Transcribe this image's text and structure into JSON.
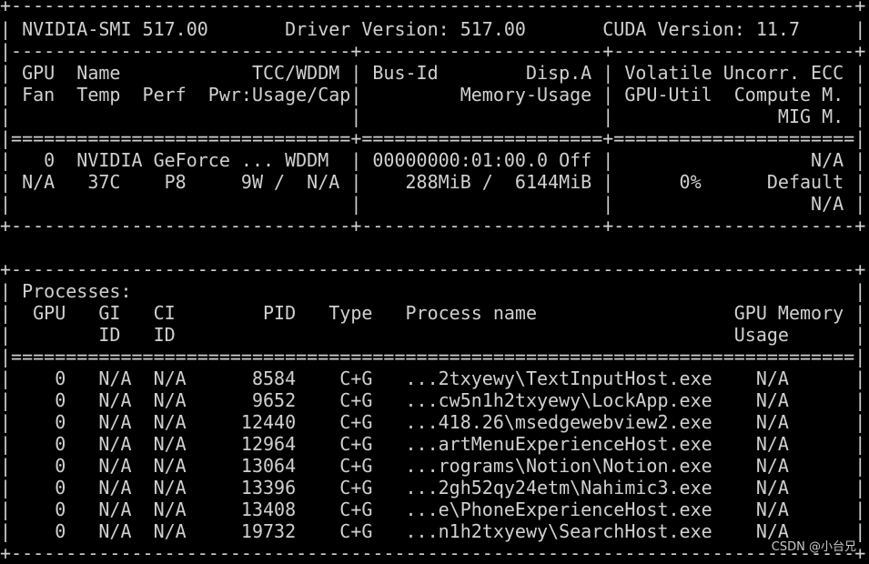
{
  "terminal": {
    "header": {
      "border_top": "+-----------------------------------------------------------------------------+",
      "title_line": "| NVIDIA-SMI 517.00       Driver Version: 517.00       CUDA Version: 11.7     |",
      "rule_mid": "|-------------------------------+----------------------+----------------------+",
      "col_head_1": "| GPU  Name            TCC/WDDM | Bus-Id        Disp.A | Volatile Uncorr. ECC |",
      "col_head_2": "| Fan  Temp  Perf  Pwr:Usage/Cap|         Memory-Usage | GPU-Util  Compute M. |",
      "col_head_3": "|                               |                      |               MIG M. |",
      "rule_eq": "|===============================+======================+======================|"
    },
    "gpu_row": {
      "line_1": "|   0  NVIDIA GeForce ... WDDM  | 00000000:01:00.0 Off |                  N/A |",
      "line_2": "| N/A   37C    P8     9W /  N/A |    288MiB /  6144MiB |      0%      Default |",
      "line_3": "|                               |                      |                  N/A |",
      "border_bottom": "+-------------------------------+----------------------+----------------------+"
    },
    "processes": {
      "border_top": "+-----------------------------------------------------------------------------+",
      "title": "| Processes:                                                                  |",
      "head_1": "|  GPU   GI   CI        PID   Type   Process name                  GPU Memory |",
      "head_2": "|        ID   ID                                                   Usage      |",
      "rule_eq": "|=============================================================================|",
      "rows": [
        "|    0   N/A  N/A      8584    C+G   ...2txyewy\\TextInputHost.exe    N/A      |",
        "|    0   N/A  N/A      9652    C+G   ...cw5n1h2txyewy\\LockApp.exe    N/A      |",
        "|    0   N/A  N/A     12440    C+G   ...418.26\\msedgewebview2.exe    N/A      |",
        "|    0   N/A  N/A     12964    C+G   ...artMenuExperienceHost.exe    N/A      |",
        "|    0   N/A  N/A     13064    C+G   ...rograms\\Notion\\Notion.exe    N/A      |",
        "|    0   N/A  N/A     13396    C+G   ...2gh52qy24etm\\Nahimic3.exe    N/A      |",
        "|    0   N/A  N/A     13408    C+G   ...e\\PhoneExperienceHost.exe    N/A      |",
        "|    0   N/A  N/A     19732    C+G   ...n1h2txyewy\\SearchHost.exe    N/A      |"
      ],
      "border_bottom": "+-----------------------------------------------------------------------------+"
    }
  },
  "watermark": "CSDN @小台兄",
  "colors": {
    "background": "#000000",
    "text": "#d0d0d0"
  }
}
